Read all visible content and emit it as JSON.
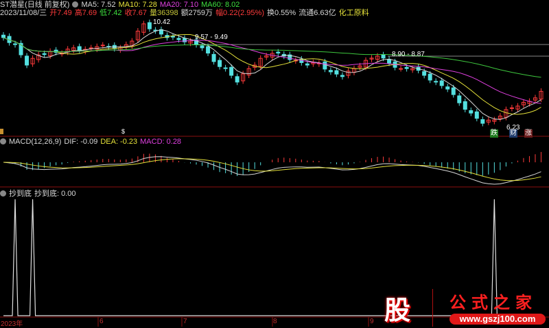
{
  "header": {
    "title": "ST潜星(日线 前复权)",
    "ma5": "MA5: 7.52",
    "ma10": "MA10: 7.28",
    "ma20": "MA20: 7.10",
    "ma60": "MA60: 8.02"
  },
  "quote": {
    "date": "2023/11/08/三",
    "open": "开7.49",
    "high": "高7.69",
    "low": "低7.42",
    "close": "收7.67",
    "volume": "量36398",
    "amount": "额2759万",
    "change": "幅0.22(2.95%)",
    "turnover": "换0.55%",
    "float_cap": "流通6.63亿",
    "industry": "化工原料"
  },
  "annotations": {
    "high": "10.42",
    "level1": "9.57 - 9.49",
    "level2": "8.90 - 8.87",
    "low": "6.23"
  },
  "tags": {
    "down": "跌",
    "finance": "财",
    "up": "涨",
    "dollar": "$"
  },
  "macd": {
    "title": "MACD(12,26,9)",
    "dif": "DIF: -0.09",
    "dea": "DEA: -0.23",
    "macd": "MACD: 0.28"
  },
  "indicator": {
    "name": "抄到底",
    "label": "抄到底: 0.00"
  },
  "xaxis": {
    "labels": [
      "2023年",
      "6",
      "7",
      "8",
      "9"
    ]
  },
  "watermark": {
    "char": "股",
    "text": "公式之家",
    "url": "www.gszj100.com"
  },
  "colors": {
    "up": "#ff3b3b",
    "down": "#54e0e0",
    "ma5": "#d8d8d8",
    "ma10": "#e6e23a",
    "ma20": "#e040e0",
    "ma60": "#3ec83e",
    "grid": "#8b1010"
  },
  "chart_data": {
    "type": "candlestick",
    "closes": [
      9.82,
      9.54,
      8.72,
      9.13,
      9.27,
      9.19,
      9.41,
      9.35,
      9.46,
      9.46,
      9.41,
      9.68,
      10.37,
      10.09,
      9.82,
      9.74,
      9.68,
      9.41,
      8.86,
      8.58,
      8.04,
      8.58,
      8.99,
      9.19,
      9.08,
      8.91,
      8.72,
      8.8,
      8.45,
      8.26,
      8.58,
      8.91,
      9.08,
      8.8,
      8.58,
      8.58,
      8.31,
      8.04,
      7.76,
      7.21,
      6.8,
      6.39,
      6.53,
      6.94,
      7.08,
      7.27,
      7.67
    ],
    "signal_candles": [
      2,
      5,
      84
    ],
    "signal_value": 1
  }
}
